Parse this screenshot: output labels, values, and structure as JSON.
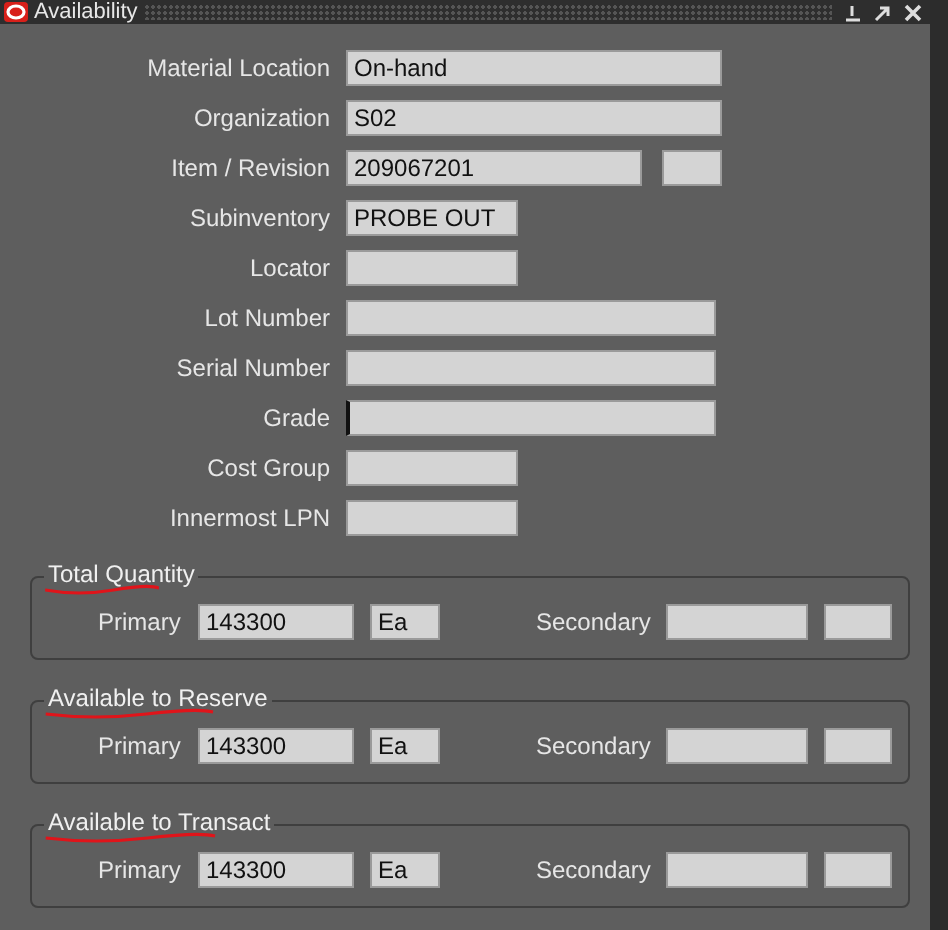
{
  "window": {
    "title": "Availability"
  },
  "fields": [
    {
      "label": "Material Location",
      "value": "On-hand",
      "kind": "wide"
    },
    {
      "label": "Organization",
      "value": "S02",
      "kind": "wide"
    },
    {
      "label": "Item / Revision",
      "value": "209067201",
      "kind": "item"
    },
    {
      "label": "Subinventory",
      "value": "PROBE OUT",
      "kind": "short"
    },
    {
      "label": "Locator",
      "kind": "short"
    },
    {
      "label": "Lot Number",
      "kind": "long"
    },
    {
      "label": "Serial Number",
      "kind": "long"
    },
    {
      "label": "Grade",
      "kind": "long",
      "focused": true
    },
    {
      "label": "Cost Group",
      "kind": "short"
    },
    {
      "label": "Innermost LPN",
      "kind": "short"
    }
  ],
  "groups": [
    {
      "title": "Total Quantity",
      "underlined": true,
      "primary_label": "Primary",
      "primary_value": "143300",
      "primary_uom": "Ea",
      "secondary_label": "Secondary"
    },
    {
      "title": "Available to Reserve",
      "underlined": true,
      "primary_label": "Primary",
      "primary_value": "143300",
      "primary_uom": "Ea",
      "secondary_label": "Secondary"
    },
    {
      "title": "Available to Transact",
      "underlined": true,
      "primary_label": "Primary",
      "primary_value": "143300",
      "primary_uom": "Ea",
      "secondary_label": "Secondary"
    }
  ]
}
